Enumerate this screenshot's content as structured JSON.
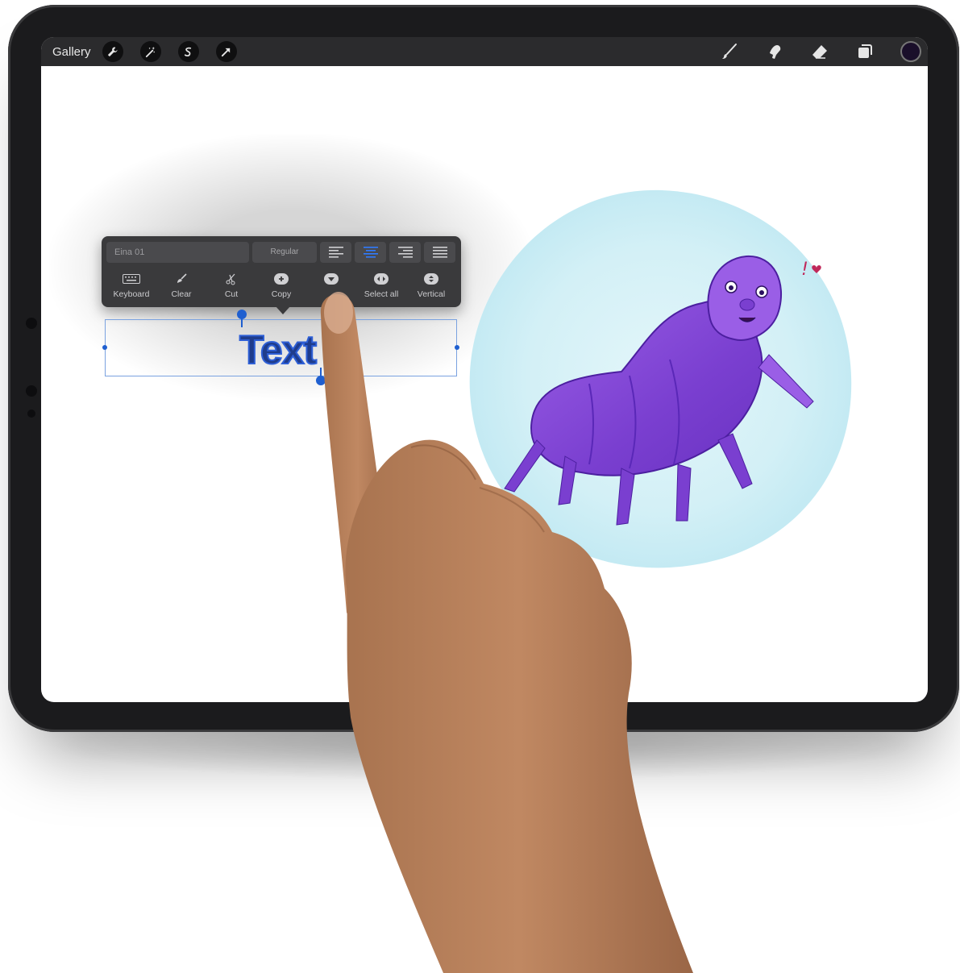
{
  "toolbar": {
    "gallery_label": "Gallery",
    "left_tools": [
      "wrench-icon",
      "magic-wand-icon",
      "selection-icon",
      "transform-arrow-icon"
    ],
    "right_tools": [
      "brush-icon",
      "smudge-icon",
      "eraser-icon",
      "layers-icon"
    ],
    "current_color": "#1a0f2a"
  },
  "text_popup": {
    "font_name": "Eina 01",
    "font_style": "Regular",
    "alignments": [
      "align-left",
      "align-center",
      "align-right",
      "align-justify"
    ],
    "selected_alignment": "align-center",
    "actions": [
      {
        "label": "Keyboard",
        "icon": "keyboard-icon"
      },
      {
        "label": "Clear",
        "icon": "clear-brush-icon"
      },
      {
        "label": "Cut",
        "icon": "scissors-icon"
      },
      {
        "label": "Copy",
        "icon": "copy-plus-icon"
      },
      {
        "label": "",
        "icon": "paste-icon"
      },
      {
        "label": "Select all",
        "icon": "select-all-icon"
      },
      {
        "label": "Vertical",
        "icon": "vertical-icon"
      }
    ]
  },
  "canvas": {
    "text_content": "Text",
    "illustration_annotation": "!",
    "accent_color": "#1f5fd0"
  }
}
